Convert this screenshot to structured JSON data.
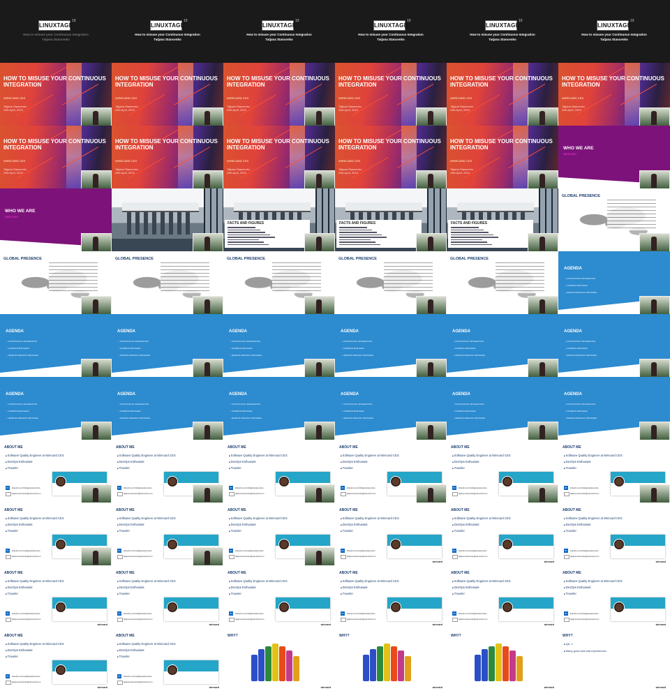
{
  "title_slide": {
    "logo": "LINUXTAGE",
    "logo_sup": "19",
    "talk": "How to misuse your Continuous Integration",
    "speaker": "Tatjana Stancenko"
  },
  "hero": {
    "title": "HOW TO MISUSE YOUR CONTINUOUS INTEGRATION",
    "company": "WIRECARD CES",
    "speaker": "Tatjana Stancenko",
    "date": "24th April, 2019"
  },
  "purple": {
    "title": "WHO WE ARE",
    "sub": "WIRECARD"
  },
  "facts": {
    "title": "FACTS AND FIGURES"
  },
  "global": {
    "title": "GLOBAL PRESENCE"
  },
  "agenda": {
    "title": "AGENDA",
    "items": [
      "CONTINUOUS INTEGRATION",
      "COMMON MISTAKES",
      "JENKINS SPECIFIC MISTAKES"
    ]
  },
  "about": {
    "title": "ABOUT ME",
    "bullets": [
      "Software Quality Engineer at Wirecard CES",
      "DevOps Enthusiast",
      "Traveler"
    ],
    "linkedin": "linkedin.com/in/tatjanastancenko",
    "email": "tatjana.stancenko@wirecard.com",
    "brand": "wirecard"
  },
  "why": {
    "title": "WHY?",
    "bullets": [
      "QA ☺",
      "Many good and bad experiences"
    ],
    "brand": "wirecard"
  }
}
